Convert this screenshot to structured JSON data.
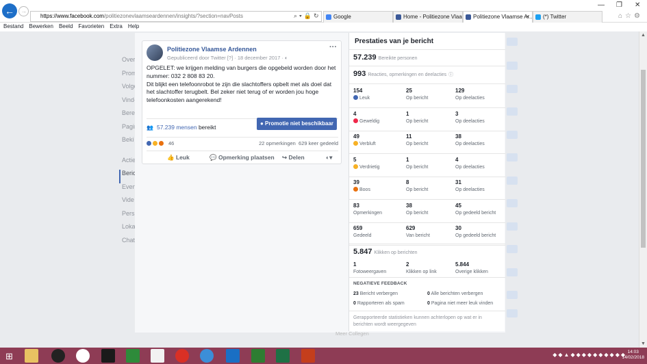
{
  "browser": {
    "url_host": "https://www.facebook.com",
    "url_rest": "/politiezonevlaamseardennen/insights/?section=navPosts",
    "tabs": [
      {
        "label": "Google",
        "color": "#4285f4"
      },
      {
        "label": "Home - Politiezone Vlaa...",
        "color": "#3b5998"
      },
      {
        "label": "Politiezone Vlaamse Ar...",
        "color": "#3b5998"
      },
      {
        "label": "(*) Twitter",
        "color": "#1da1f2"
      }
    ],
    "menu": [
      "Bestand",
      "Bewerken",
      "Beeld",
      "Favorieten",
      "Extra",
      "Help"
    ]
  },
  "leftnav": [
    "Overz",
    "Prom",
    "Volge",
    "Vind-",
    "Berei",
    "Pagir",
    "Beki",
    "Actie",
    "Beric",
    "Even",
    "Vide",
    "Pers",
    "Loka",
    "Chat"
  ],
  "post": {
    "page_name": "Politiezone Vlaamse Ardennen",
    "published_by": "Gepubliceerd door Twitter [?] · 18 december 2017 · ",
    "text": "OPGELET: we krijgen melding van burgers die opgebeld worden door het nummer: 032 2 808 83 20.\nDit blijkt een telefoonrobot te zijn die slachtoffers opbelt met als doel dat het slachtoffer terugbelt. Bel zeker niet terug of er worden jou hoge telefoonkosten aangerekend!",
    "reach_num": "57.239 mensen",
    "reach_label": "bereikt",
    "promo": "Promotie niet beschikbaar",
    "reaction_count": "46",
    "comments": "22 opmerkingen",
    "shares": "629 keer gedeeld",
    "actions": {
      "like": "Leuk",
      "comment": "Opmerking plaatsen",
      "share": "Delen"
    }
  },
  "panel": {
    "title": "Prestaties van je bericht",
    "reached": "57.239",
    "reached_label": "Bereikte personen",
    "engagement": "993",
    "engagement_label": "Reacties, opmerkingen en deelacties",
    "rows": [
      {
        "a": "154",
        "al": "Leuk",
        "b": "25",
        "bl": "Op bericht",
        "c": "129",
        "cl": "Op deelacties",
        "emo": "#4267b2"
      },
      {
        "a": "4",
        "al": "Geweldig",
        "b": "1",
        "bl": "Op bericht",
        "c": "3",
        "cl": "Op deelacties",
        "emo": "#f0284a"
      },
      {
        "a": "49",
        "al": "Verbluft",
        "b": "11",
        "bl": "Op bericht",
        "c": "38",
        "cl": "Op deelacties",
        "emo": "#f7b125"
      },
      {
        "a": "5",
        "al": "Verdrietig",
        "b": "1",
        "bl": "Op bericht",
        "c": "4",
        "cl": "Op deelacties",
        "emo": "#f7b125"
      },
      {
        "a": "39",
        "al": "Boos",
        "b": "8",
        "bl": "Op bericht",
        "c": "31",
        "cl": "Op deelacties",
        "emo": "#e9710f"
      },
      {
        "a": "83",
        "al": "Opmerkingen",
        "b": "38",
        "bl": "Op bericht",
        "c": "45",
        "cl": "Op gedeeld bericht",
        "emo": ""
      },
      {
        "a": "659",
        "al": "Gedeeld",
        "b": "629",
        "bl": "Van bericht",
        "c": "30",
        "cl": "Op gedeeld bericht",
        "emo": ""
      }
    ],
    "clicks": "5.847",
    "clicks_label": "Klikken op berichten",
    "click_row": {
      "a": "1",
      "al": "Fotoweergaven",
      "b": "2",
      "bl": "Klikken op link",
      "c": "5.844",
      "cl": "Overige klikken"
    },
    "neg_title": "NEGATIEVE FEEDBACK",
    "neg": [
      {
        "n": "23",
        "l": "Bericht verbergen"
      },
      {
        "n": "0",
        "l": "Alle berichten verbergen"
      },
      {
        "n": "0",
        "l": "Rapporteren als spam"
      },
      {
        "n": "0",
        "l": "Pagina niet meer leuk vinden"
      }
    ],
    "note": "Gerapporteerde statistieken kunnen achterlopen op wat er in berichten wordt weergegeven"
  },
  "watermark": "Meer Collegen",
  "clock": {
    "time": "14:03",
    "date": "14/02/2018"
  }
}
